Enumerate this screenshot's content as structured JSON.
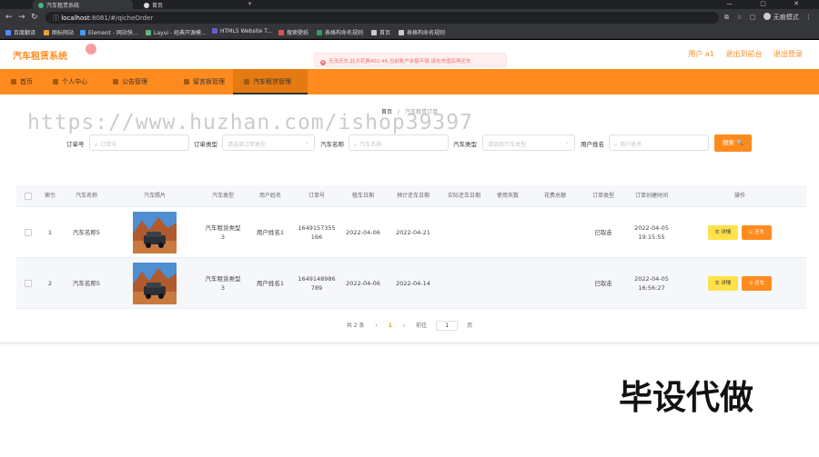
{
  "browser": {
    "tabs": [
      {
        "label": "汽车租赁系统",
        "active": true
      },
      {
        "label": "首页",
        "active": false
      }
    ],
    "new_tab": "+",
    "window_controls": "—  ▢  ✕",
    "url_host": "localhost",
    "url_path": ":8081/#/qicheOrder",
    "profile": "无痕模式",
    "bookmarks": [
      {
        "label": "百度翻译",
        "color": "#4e8cff"
      },
      {
        "label": "图标网站",
        "color": "#e8a23a"
      },
      {
        "label": "Element - 网站快...",
        "color": "#409eff"
      },
      {
        "label": "Layui - 经典开源模...",
        "color": "#5fb878"
      },
      {
        "label": "HTML5 Website T...",
        "color": "#6a5acd"
      },
      {
        "label": "搜索壁纸",
        "color": "#e05050"
      },
      {
        "label": "表格构命名规则",
        "color": "#2e9e5b"
      },
      {
        "label": "首页",
        "color": "#cccccc"
      },
      {
        "label": "表格构命名规则",
        "color": "#cccccc"
      }
    ]
  },
  "app": {
    "brand": "汽车租赁系统",
    "toast": "无法还车,此次花费402.46,当前账户余额不够,请去充值后再还车",
    "header_links": [
      "用户 a1",
      "退出到前台",
      "退出登录"
    ],
    "menu": [
      {
        "label": "首页",
        "active": false
      },
      {
        "label": "个人中心",
        "active": false
      },
      {
        "label": "公告管理",
        "active": false
      },
      {
        "label": "留言板管理",
        "active": false
      },
      {
        "label": "汽车租赁管理",
        "active": true
      }
    ],
    "breadcrumb": {
      "home": "首页",
      "sep": "/",
      "current": "汽车租赁订单"
    },
    "search": {
      "order_no_label": "订单号",
      "order_no_placeholder": "订单号",
      "order_type_label": "订单类型",
      "order_type_placeholder": "请选择订单类型",
      "car_name_label": "汽车名称",
      "car_name_placeholder": "汽车名称",
      "car_type_label": "汽车类型",
      "car_type_placeholder": "请选择汽车类型",
      "user_name_label": "用户姓名",
      "user_name_placeholder": "用户姓名",
      "button": "搜索 🔍"
    },
    "table": {
      "columns": [
        "索引",
        "汽车名称",
        "汽车照片",
        "汽车类型",
        "用户姓名",
        "订单号",
        "租车日期",
        "预计还车日期",
        "实际还车日期",
        "使用天数",
        "花费总额",
        "订单类型",
        "订单创建时间",
        "操作"
      ],
      "rows": [
        {
          "index": "1",
          "car_name": "汽车名称5",
          "car_type_1": "汽车租赁类型",
          "car_type_2": "3",
          "user_name": "用户姓名1",
          "order_no_1": "1649157355",
          "order_no_2": "166",
          "rent_date": "2022-04-06",
          "expected_return": "2022-04-21",
          "actual_return": "",
          "days": "",
          "cost": "",
          "order_type": "已取走",
          "created_1": "2022-04-05",
          "created_2": "19:15:55",
          "detail": "☰ 详情",
          "return": "⊙ 还车"
        },
        {
          "index": "2",
          "car_name": "汽车名称5",
          "car_type_1": "汽车租赁类型",
          "car_type_2": "3",
          "user_name": "用户姓名1",
          "order_no_1": "1649148986",
          "order_no_2": "789",
          "rent_date": "2022-04-06",
          "expected_return": "2022-04-14",
          "actual_return": "",
          "days": "",
          "cost": "",
          "order_type": "已取走",
          "created_1": "2022-04-05",
          "created_2": "16:56:27",
          "detail": "☰ 详情",
          "return": "⊙ 还车"
        }
      ]
    },
    "pager": {
      "total": "共 2 条",
      "prev": "‹",
      "current": "1",
      "next": "›",
      "goto": "前往",
      "page_value": "1",
      "page_unit": "页"
    }
  },
  "overlay": {
    "watermark": "https://www.huzhan.com/ishop39397",
    "corner_text": "毕设代做"
  }
}
